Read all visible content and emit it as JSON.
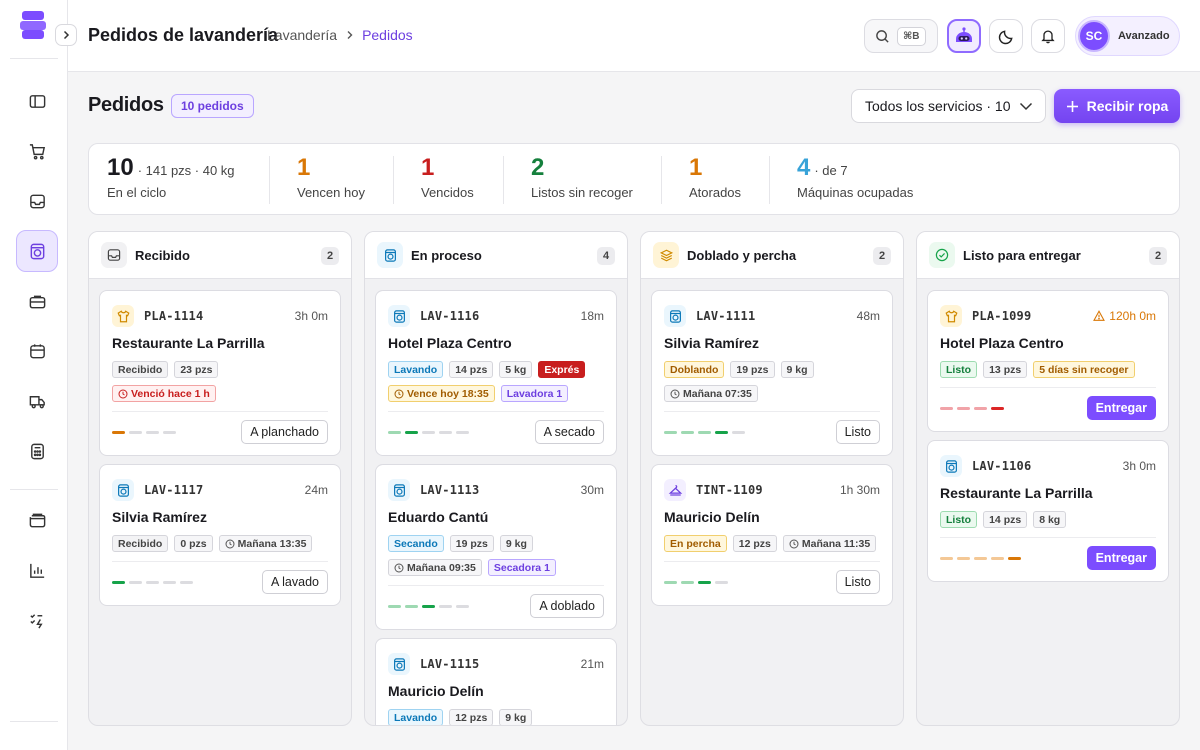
{
  "header": {
    "title": "Pedidos de lavandería",
    "breadcrumb": [
      "Lavandería",
      "Pedidos"
    ],
    "search_shortcut": "⌘B",
    "user": {
      "initials": "SC",
      "level": "Avanzado"
    }
  },
  "section": {
    "title": "Pedidos",
    "badge": "10 pedidos",
    "filter": "Todos los servicios · 10",
    "primary_action": "Recibir ropa"
  },
  "stats": [
    {
      "value": "10",
      "detail": "·  141 pzs · 40 kg",
      "label": "En el ciclo",
      "color": "#1a1a1f"
    },
    {
      "value": "1",
      "detail": "",
      "label": "Vencen hoy",
      "color": "#d97706"
    },
    {
      "value": "1",
      "detail": "",
      "label": "Vencidos",
      "color": "#c81e1e"
    },
    {
      "value": "2",
      "detail": "",
      "label": "Listos sin recoger",
      "color": "#15803d"
    },
    {
      "value": "1",
      "detail": "",
      "label": "Atorados",
      "color": "#d97706"
    },
    {
      "value": "4",
      "detail": "·  de 7",
      "label": "Máquinas ocupadas",
      "color": "#38a3d8"
    }
  ],
  "columns": [
    {
      "title": "Recibido",
      "count": "2",
      "icon": "inbox-icon",
      "cards": [
        {
          "code": "PLA-1114",
          "type": "shirt-icon",
          "elapsed": "3h 0m",
          "elapsed_warn": false,
          "client": "Restaurante La Parrilla",
          "tags": [
            {
              "text": "Recibido",
              "cls": "st-recibido"
            },
            {
              "text": "23 pzs",
              "cls": ""
            }
          ],
          "tags2": [
            {
              "text": "Venció hace 1 h",
              "cls": "red",
              "icon": "clock-icon"
            }
          ],
          "progress": [
            1,
            0,
            0,
            0
          ],
          "progress_color": "#d97706",
          "action": "A planchado",
          "action_primary": false
        },
        {
          "code": "LAV-1117",
          "type": "washer-icon",
          "elapsed": "24m",
          "elapsed_warn": false,
          "client": "Silvia Ramírez",
          "tags": [
            {
              "text": "Recibido",
              "cls": "st-recibido"
            },
            {
              "text": "0 pzs",
              "cls": ""
            },
            {
              "text": "Mañana 13:35",
              "cls": "",
              "icon": "clock-icon"
            }
          ],
          "tags2": [],
          "progress": [
            1,
            0,
            0,
            0,
            0
          ],
          "progress_color": "#16a34a",
          "action": "A lavado",
          "action_primary": false
        }
      ]
    },
    {
      "title": "En proceso",
      "count": "4",
      "icon": "washer-icon",
      "cards": [
        {
          "code": "LAV-1116",
          "type": "washer-icon",
          "elapsed": "18m",
          "elapsed_warn": false,
          "client": "Hotel Plaza Centro",
          "tags": [
            {
              "text": "Lavando",
              "cls": "st-lavando"
            },
            {
              "text": "14 pzs",
              "cls": ""
            },
            {
              "text": "5 kg",
              "cls": ""
            },
            {
              "text": "Exprés",
              "cls": "express"
            }
          ],
          "tags2": [
            {
              "text": "Vence hoy 18:35",
              "cls": "amber",
              "icon": "clock-icon"
            },
            {
              "text": "Lavadora 1",
              "cls": "purple"
            }
          ],
          "progress": [
            1,
            1,
            0,
            0,
            0
          ],
          "progress_color": "#16a34a",
          "action": "A secado",
          "action_primary": false
        },
        {
          "code": "LAV-1113",
          "type": "washer-icon",
          "elapsed": "30m",
          "elapsed_warn": false,
          "client": "Eduardo Cantú",
          "tags": [
            {
              "text": "Secando",
              "cls": "st-secando"
            },
            {
              "text": "19 pzs",
              "cls": ""
            },
            {
              "text": "9 kg",
              "cls": ""
            }
          ],
          "tags2": [
            {
              "text": "Mañana 09:35",
              "cls": "",
              "icon": "clock-icon"
            },
            {
              "text": "Secadora 1",
              "cls": "purple"
            }
          ],
          "progress": [
            1,
            1,
            1,
            0,
            0
          ],
          "progress_color": "#16a34a",
          "action": "A doblado",
          "action_primary": false
        },
        {
          "code": "LAV-1115",
          "type": "washer-icon",
          "elapsed": "21m",
          "elapsed_warn": false,
          "client": "Mauricio Delín",
          "tags": [
            {
              "text": "Lavando",
              "cls": "st-lavando"
            },
            {
              "text": "12 pzs",
              "cls": ""
            },
            {
              "text": "9 kg",
              "cls": ""
            }
          ],
          "tags2": [],
          "progress": [],
          "progress_color": "#16a34a",
          "action": "",
          "action_primary": false
        }
      ]
    },
    {
      "title": "Doblado y percha",
      "count": "2",
      "icon": "stack-icon",
      "cards": [
        {
          "code": "LAV-1111",
          "type": "washer-icon",
          "elapsed": "48m",
          "elapsed_warn": false,
          "client": "Silvia Ramírez",
          "tags": [
            {
              "text": "Doblando",
              "cls": "st-doblando"
            },
            {
              "text": "19 pzs",
              "cls": ""
            },
            {
              "text": "9 kg",
              "cls": ""
            }
          ],
          "tags2": [
            {
              "text": "Mañana 07:35",
              "cls": "",
              "icon": "clock-icon"
            }
          ],
          "progress": [
            1,
            1,
            1,
            1,
            0
          ],
          "progress_color": "#16a34a",
          "action": "Listo",
          "action_primary": false
        },
        {
          "code": "TINT-1109",
          "type": "iron-icon",
          "elapsed": "1h 30m",
          "elapsed_warn": false,
          "client": "Mauricio Delín",
          "tags": [
            {
              "text": "En percha",
              "cls": "st-percha"
            },
            {
              "text": "12 pzs",
              "cls": ""
            },
            {
              "text": "Mañana 11:35",
              "cls": "",
              "icon": "clock-icon"
            }
          ],
          "tags2": [],
          "progress": [
            1,
            1,
            1,
            0
          ],
          "progress_color": "#16a34a",
          "action": "Listo",
          "action_primary": false
        }
      ]
    },
    {
      "title": "Listo para entregar",
      "count": "2",
      "icon": "check-circle-icon",
      "cards": [
        {
          "code": "PLA-1099",
          "type": "shirt-icon",
          "elapsed": "120h 0m",
          "elapsed_warn": true,
          "client": "Hotel Plaza Centro",
          "tags": [
            {
              "text": "Listo",
              "cls": "st-listo"
            },
            {
              "text": "13 pzs",
              "cls": ""
            },
            {
              "text": "5 días sin recoger",
              "cls": "amber"
            }
          ],
          "tags2": [],
          "progress": [
            1,
            1,
            1,
            1
          ],
          "progress_color": "#dc2626",
          "action": "Entregar",
          "action_primary": true
        },
        {
          "code": "LAV-1106",
          "type": "washer-icon",
          "elapsed": "3h 0m",
          "elapsed_warn": false,
          "client": "Restaurante La Parrilla",
          "tags": [
            {
              "text": "Listo",
              "cls": "st-listo"
            },
            {
              "text": "14 pzs",
              "cls": ""
            },
            {
              "text": "8 kg",
              "cls": ""
            }
          ],
          "tags2": [],
          "progress": [
            1,
            1,
            1,
            1,
            1
          ],
          "progress_color": "#d97706",
          "action": "Entregar",
          "action_primary": true
        }
      ]
    }
  ]
}
